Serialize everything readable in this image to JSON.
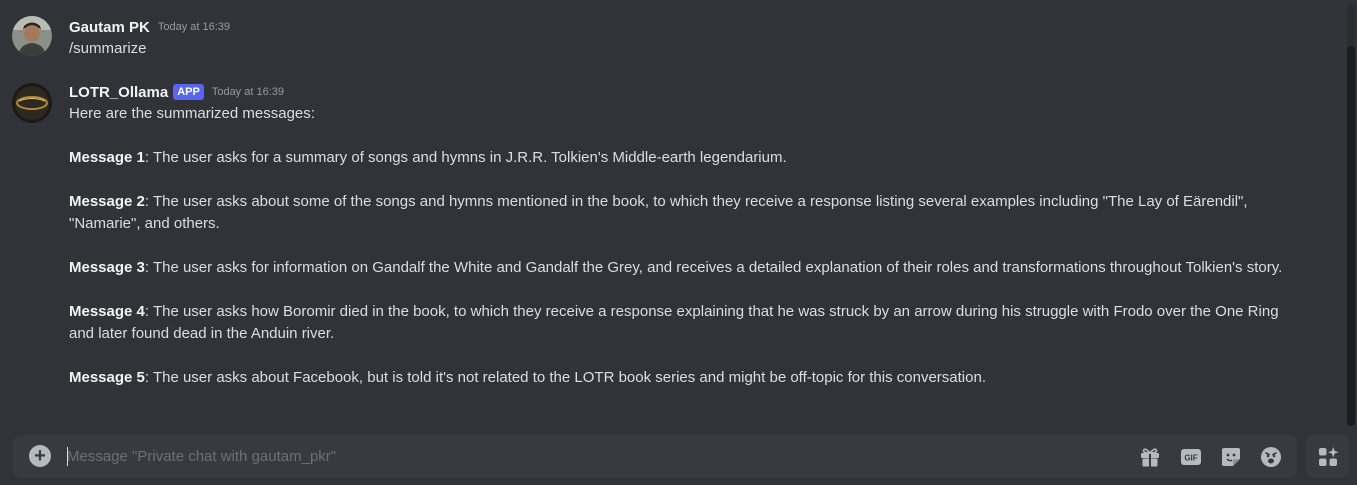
{
  "messages": [
    {
      "username": "Gautam PK",
      "timestamp": "Today at 16:39",
      "text": "/summarize"
    },
    {
      "username": "LOTR_Ollama",
      "badge": "APP",
      "timestamp": "Today at 16:39",
      "intro": "Here are the summarized messages:",
      "items": [
        {
          "label": "Message 1",
          "text": ": The user asks for a summary of songs and hymns in J.R.R. Tolkien's Middle-earth legendarium."
        },
        {
          "label": "Message 2",
          "text": ": The user asks about some of the songs and hymns mentioned in the book, to which they receive a response listing several examples including \"The Lay of Eärendil\", \"Namarie\", and others."
        },
        {
          "label": "Message 3",
          "text": ": The user asks for information on Gandalf the White and Gandalf the Grey, and receives a detailed explanation of their roles and transformations throughout Tolkien's story."
        },
        {
          "label": "Message 4",
          "text": ": The user asks how Boromir died in the book, to which they receive a response explaining that he was struck by an arrow during his struggle with Frodo over the One Ring and later found dead in the Anduin river."
        },
        {
          "label": "Message 5",
          "text": ": The user asks about Facebook, but is told it's not related to the LOTR book series and might be off-topic for this conversation."
        }
      ]
    }
  ],
  "composer": {
    "placeholder": "Message \"Private chat with gautam_pkr\"",
    "gif_label": "GIF"
  },
  "icons": {
    "add": "plus-circle-icon",
    "gift": "gift-icon",
    "gif": "gif-icon",
    "sticker": "sticker-icon",
    "emoji": "emoji-icon",
    "apps": "apps-icon"
  },
  "colors": {
    "background": "#313338",
    "composer": "#383a40",
    "app_badge": "#5865f2",
    "text": "#dbdee1",
    "muted": "#949ba4"
  }
}
